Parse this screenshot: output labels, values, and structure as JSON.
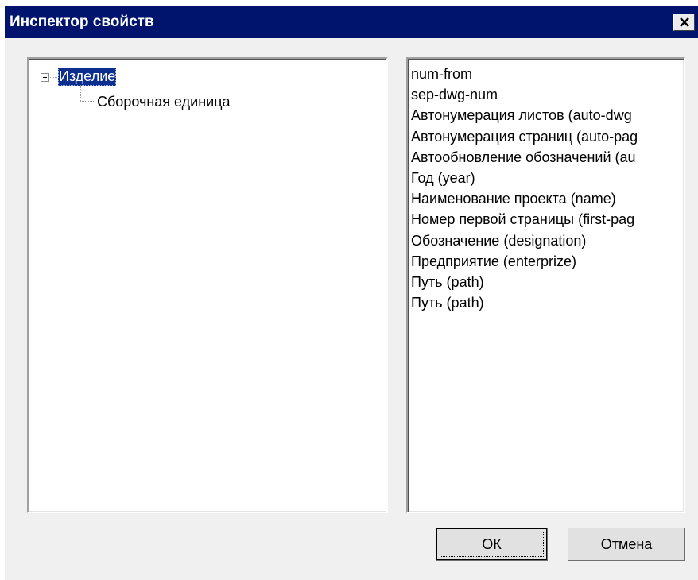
{
  "window": {
    "title": "Инспектор свойств",
    "colors": {
      "titlebar": "#00146e",
      "selection": "#0c2e8e",
      "face": "#f0f0f0"
    },
    "close_icon": "close-icon"
  },
  "tree": {
    "root": {
      "label": "Изделие",
      "expanded": true,
      "selected": true
    },
    "children": [
      {
        "label": "Сборочная единица"
      }
    ]
  },
  "properties": [
    "num-from",
    "sep-dwg-num",
    "Автонумерация листов (auto-dwg",
    "Автонумерация страниц (auto-pag",
    "Автообновление обозначений (au",
    "Год (year)",
    "Наименование проекта (name)",
    "Номер первой страницы (first-pag",
    "Обозначение (designation)",
    "Предприятие (enterprize)",
    "Путь (path)",
    "Путь (path)"
  ],
  "buttons": {
    "ok": "ОК",
    "cancel": "Отмена"
  }
}
